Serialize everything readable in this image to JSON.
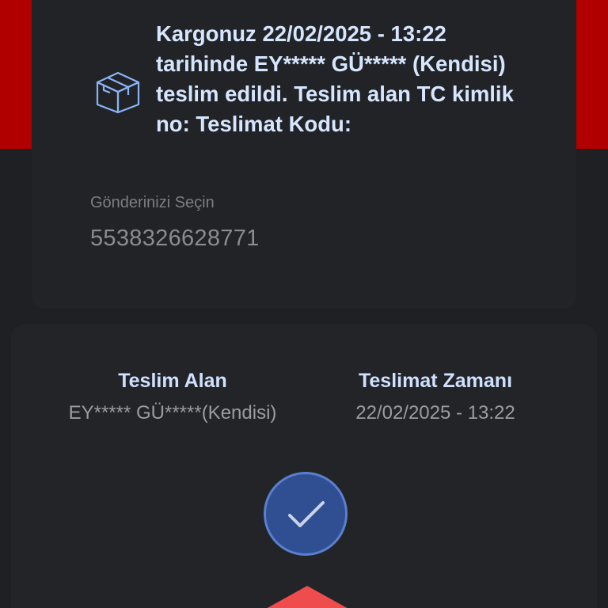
{
  "status": {
    "message": "Kargonuz 22/02/2025 - 13:22 tarihinde EY***** GÜ***** (Kendisi) teslim edildi. Teslim alan TC kimlik no: Teslimat Kodu:",
    "icon": "package-icon"
  },
  "shipment": {
    "select_label": "Gönderinizi Seçin",
    "tracking_number": "5538326628771"
  },
  "delivery": {
    "receiver_title": "Teslim Alan",
    "receiver_value": "EY***** GÜ*****(Kendisi)",
    "time_title": "Teslimat Zamanı",
    "time_value": "22/02/2025 - 13:22"
  },
  "confirm": {
    "icon": "checkmark-icon"
  },
  "colors": {
    "accent_red": "#b00000",
    "title_text": "#d6e6ff",
    "check_button_bg": "#304f93",
    "bottom_triangle": "#ef4d4d"
  }
}
